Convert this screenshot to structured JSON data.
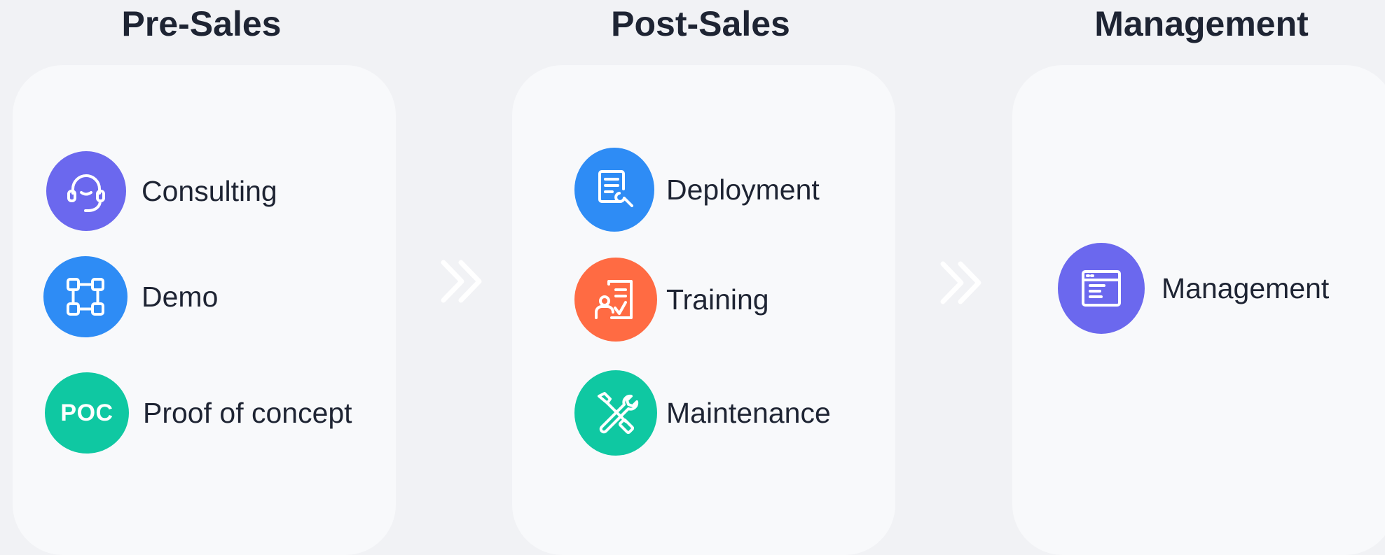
{
  "columns": [
    {
      "title": "Pre-Sales",
      "items": [
        {
          "label": "Consulting",
          "icon": "headset-icon",
          "color": "#6B68EE"
        },
        {
          "label": "Demo",
          "icon": "network-nodes-icon",
          "color": "#2E8CF5"
        },
        {
          "label": "Proof of concept",
          "icon": "poc-icon",
          "icon_text": "POC",
          "color": "#0FC8A2"
        }
      ]
    },
    {
      "title": "Post-Sales",
      "items": [
        {
          "label": "Deployment",
          "icon": "document-wrench-icon",
          "color": "#2E8CF5"
        },
        {
          "label": "Training",
          "icon": "trainer-board-icon",
          "color": "#FF6B43"
        },
        {
          "label": "Maintenance",
          "icon": "crossed-tools-icon",
          "color": "#0FC8A2"
        }
      ]
    },
    {
      "title": "Management",
      "items": [
        {
          "label": "Management",
          "icon": "app-window-icon",
          "color": "#6B68EE"
        }
      ]
    }
  ],
  "connectors": [
    {
      "icon": "double-chevron-right-icon"
    },
    {
      "icon": "double-chevron-right-icon"
    }
  ],
  "theme": {
    "background": "#F1F2F5",
    "panel": "#F8F9FB",
    "text": "#1E2433"
  }
}
